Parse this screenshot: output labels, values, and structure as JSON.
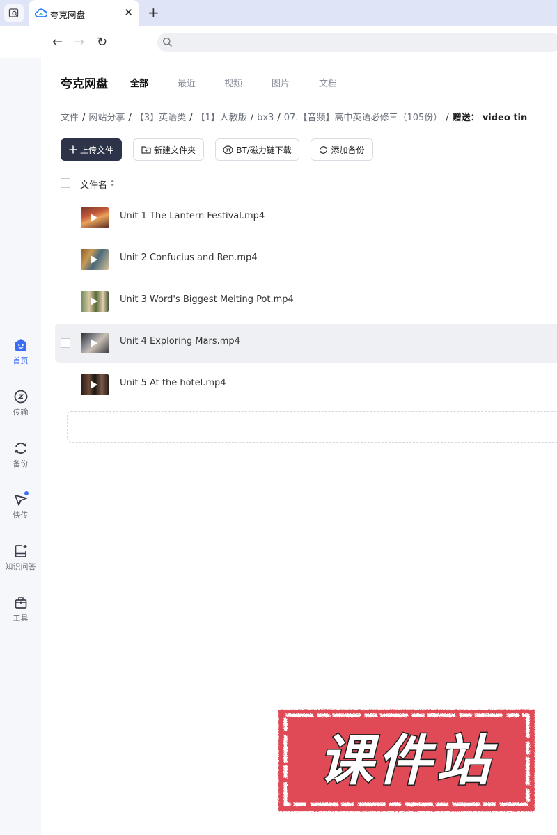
{
  "browser": {
    "tab_title": "夸克网盘",
    "close_glyph": "✕",
    "new_tab_glyph": "+",
    "back_glyph": "←",
    "forward_glyph": "→",
    "reload_glyph": "↻"
  },
  "rail": {
    "items": [
      {
        "label": "首页",
        "icon": "home-icon",
        "active": true
      },
      {
        "label": "传输",
        "icon": "transfer-icon"
      },
      {
        "label": "备份",
        "icon": "backup-icon"
      },
      {
        "label": "快传",
        "icon": "paper-plane-icon",
        "badge_dot": true
      },
      {
        "label": "知识问答",
        "icon": "knowledge-qa-icon"
      },
      {
        "label": "工具",
        "icon": "toolbox-icon"
      }
    ]
  },
  "header": {
    "brand": "夸克网盘",
    "tabs": [
      {
        "label": "全部",
        "active": true
      },
      {
        "label": "最近"
      },
      {
        "label": "视频"
      },
      {
        "label": "图片"
      },
      {
        "label": "文档"
      }
    ]
  },
  "breadcrumb": {
    "items": [
      "文件",
      "网站分享",
      "【3】英语类",
      "【1】人教版",
      "bx3",
      "07.【音频】高中英语必修三（105份）"
    ],
    "separator": "/",
    "gift_label": "赠送：",
    "gift_value": "video tin"
  },
  "toolbar": {
    "upload": "上传文件",
    "new_folder": "新建文件夹",
    "bt_download": "BT/磁力链下载",
    "add_backup": "添加备份"
  },
  "list": {
    "header_label": "文件名",
    "files": [
      {
        "name": "Unit 1 The Lantern Festival.mp4"
      },
      {
        "name": "Unit 2 Confucius and Ren.mp4"
      },
      {
        "name": "Unit 3 Word's Biggest Melting Pot.mp4"
      },
      {
        "name": "Unit 4 Exploring Mars.mp4",
        "hovered": true
      },
      {
        "name": "Unit 5 At the hotel.mp4"
      }
    ]
  },
  "watermark": {
    "text": "课件站"
  },
  "colors": {
    "accent": "#3b6cf4",
    "primary_button": "#2d3449",
    "stamp_red": "#e04a57",
    "tabbar_bg": "#dfe5f6"
  }
}
